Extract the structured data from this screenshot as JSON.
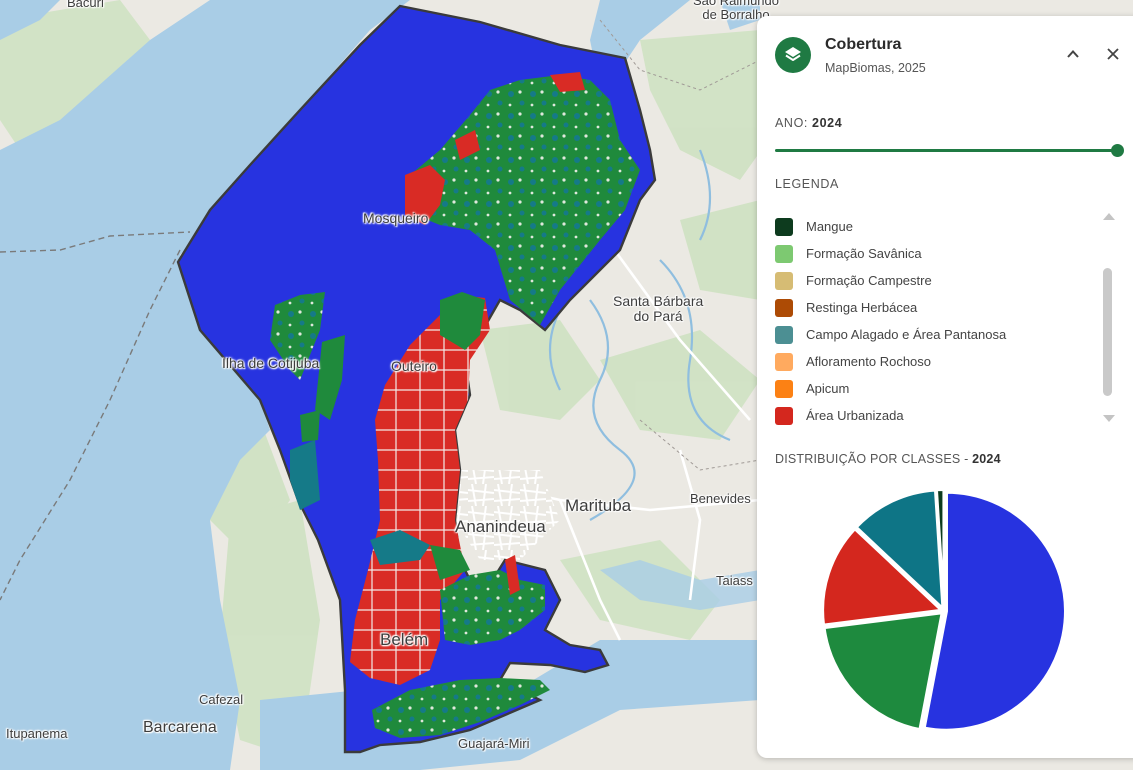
{
  "map": {
    "places": [
      {
        "id": "bacuri",
        "label": "Bacuri"
      },
      {
        "id": "sao-raimundo",
        "label": "São Raimundo\nde Borralho"
      },
      {
        "id": "mosqueiro",
        "label": "Mosqueiro"
      },
      {
        "id": "santa-barbara",
        "label": "Santa Bárbara\ndo Pará"
      },
      {
        "id": "ilha-cotijuba",
        "label": "Ilha de Cotijuba"
      },
      {
        "id": "outeiro",
        "label": "Outeiro"
      },
      {
        "id": "marituba",
        "label": "Marituba"
      },
      {
        "id": "benevides",
        "label": "Benevides"
      },
      {
        "id": "ananindeua",
        "label": "Ananindeua"
      },
      {
        "id": "taiass",
        "label": "Taiass"
      },
      {
        "id": "belem",
        "label": "Belém"
      },
      {
        "id": "cafezal",
        "label": "Cafezal"
      },
      {
        "id": "barcarena",
        "label": "Barcarena"
      },
      {
        "id": "itupanema",
        "label": "Itupanema"
      },
      {
        "id": "guajara-miri",
        "label": "Guajará-Miri"
      }
    ],
    "colors": {
      "water": "#a9cde6",
      "land": "#ebe9e3",
      "vegetation": "#cfe2c2",
      "municipality": "#2733e0",
      "forest": "#1f8a3c",
      "urban": "#d92b25",
      "wetland": "#157a88"
    }
  },
  "panel": {
    "title": "Cobertura",
    "subtitle": "MapBiomas, 2025",
    "year_label": "ANO:",
    "year_value": "2024",
    "legend_label": "LEGENDA",
    "legend": [
      {
        "label": "Mangue",
        "color": "#0d3b1e"
      },
      {
        "label": "Formação Savânica",
        "color": "#7dc971"
      },
      {
        "label": "Formação Campestre",
        "color": "#d6bc74"
      },
      {
        "label": "Restinga Herbácea",
        "color": "#ad4b05"
      },
      {
        "label": "Campo Alagado e Área Pantanosa",
        "color": "#4c8f93"
      },
      {
        "label": "Afloramento Rochoso",
        "color": "#ffaa5f"
      },
      {
        "label": "Apicum",
        "color": "#fc8114"
      },
      {
        "label": "Área Urbanizada",
        "color": "#d4271e"
      }
    ],
    "dist_label": "DISTRIBUIÇÃO POR CLASSES -",
    "dist_year": "2024",
    "icons": {
      "header": "layers-icon",
      "collapse": "chevron-up-icon",
      "close": "close-icon"
    }
  },
  "chart_data": {
    "type": "pie",
    "slices": [
      {
        "color": "#2733e0",
        "value": 53
      },
      {
        "color": "#1e8a3e",
        "value": 20
      },
      {
        "color": "#d4271e",
        "value": 14
      },
      {
        "color": "#0e7586",
        "value": 12
      },
      {
        "color": "#0d3b1e",
        "value": 1
      }
    ]
  }
}
